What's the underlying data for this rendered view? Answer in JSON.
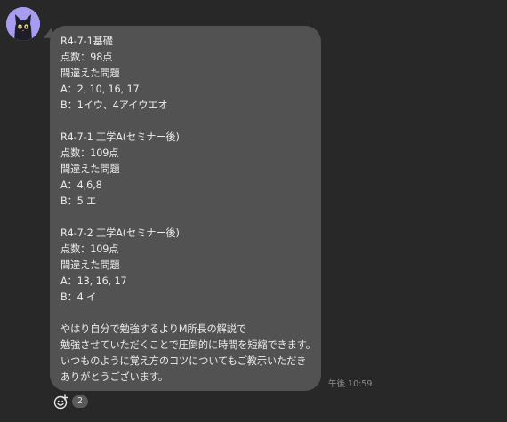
{
  "message": {
    "lines": [
      "R4-7-1基礎",
      "点数：98点",
      "間違えた問題",
      "A：2, 10, 16, 17",
      "B：1イウ、4アイウエオ",
      "",
      "R4-7-1 工学A(セミナー後)",
      "点数：109点",
      "間違えた問題",
      "A：4,6,8",
      "B：5 エ",
      "",
      "R4-7-2 工学A(セミナー後)",
      "点数：109点",
      "間違えた問題",
      "A：13, 16, 17",
      "B：4 イ",
      "",
      "やはり自分で勉強するよりM所長の解説で",
      "勉強させていただくことで圧倒的に時間を短縮できます。",
      "いつものように覚え方のコツについてもご教示いただき",
      "ありがとうございます。"
    ],
    "timestamp": "午後 10:59"
  },
  "avatar": {
    "icon": "black-cat-icon",
    "background_color": "#a79df0"
  },
  "reaction": {
    "icon": "smiley-reaction-icon",
    "count": "2"
  },
  "colors": {
    "background": "#282828",
    "bubble": "#525252",
    "text": "#ececec",
    "timestamp": "#8c8c8c"
  }
}
